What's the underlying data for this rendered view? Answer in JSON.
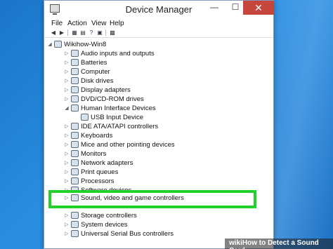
{
  "window": {
    "title": "Device Manager",
    "minimize": "—",
    "maximize": "☐",
    "close": "✕"
  },
  "menu": [
    "File",
    "Action",
    "View",
    "Help"
  ],
  "toolbar_icons": [
    "back-icon",
    "forward-icon",
    "properties-icon",
    "help-icon",
    "scan-icon",
    "display-icon"
  ],
  "tree": {
    "root": "Wikihow-Win8",
    "items": [
      {
        "label": "Audio inputs and outputs",
        "icon": "speaker-icon",
        "expanded": false
      },
      {
        "label": "Batteries",
        "icon": "battery-icon",
        "expanded": false
      },
      {
        "label": "Computer",
        "icon": "computer-icon",
        "expanded": false
      },
      {
        "label": "Disk drives",
        "icon": "disk-icon",
        "expanded": false
      },
      {
        "label": "Display adapters",
        "icon": "display-adapter-icon",
        "expanded": false
      },
      {
        "label": "DVD/CD-ROM drives",
        "icon": "dvd-icon",
        "expanded": false
      },
      {
        "label": "Human Interface Devices",
        "icon": "hid-icon",
        "expanded": true
      },
      {
        "label": "USB Input Device",
        "icon": "usb-input-icon",
        "child": true
      },
      {
        "label": "IDE ATA/ATAPI controllers",
        "icon": "ide-icon",
        "expanded": false
      },
      {
        "label": "Keyboards",
        "icon": "keyboard-icon",
        "expanded": false
      },
      {
        "label": "Mice and other pointing devices",
        "icon": "mouse-icon",
        "expanded": false
      },
      {
        "label": "Monitors",
        "icon": "monitor-icon",
        "expanded": false
      },
      {
        "label": "Network adapters",
        "icon": "network-icon",
        "expanded": false
      },
      {
        "label": "Print queues",
        "icon": "printer-icon",
        "expanded": false
      },
      {
        "label": "Processors",
        "icon": "processor-icon",
        "expanded": false
      },
      {
        "label": "Software devices",
        "icon": "software-icon",
        "expanded": false
      },
      {
        "label": "Sound, video and game controllers",
        "icon": "sound-icon",
        "expanded": false,
        "highlighted": true
      },
      {
        "label": "Storage controllers",
        "icon": "storage-icon",
        "expanded": false
      },
      {
        "label": "System devices",
        "icon": "system-icon",
        "expanded": false
      },
      {
        "label": "Universal Serial Bus controllers",
        "icon": "usb-icon",
        "expanded": false
      }
    ]
  },
  "highlight_color": "#22d22a",
  "watermark": "wikiHow to Detect a Sound Card"
}
